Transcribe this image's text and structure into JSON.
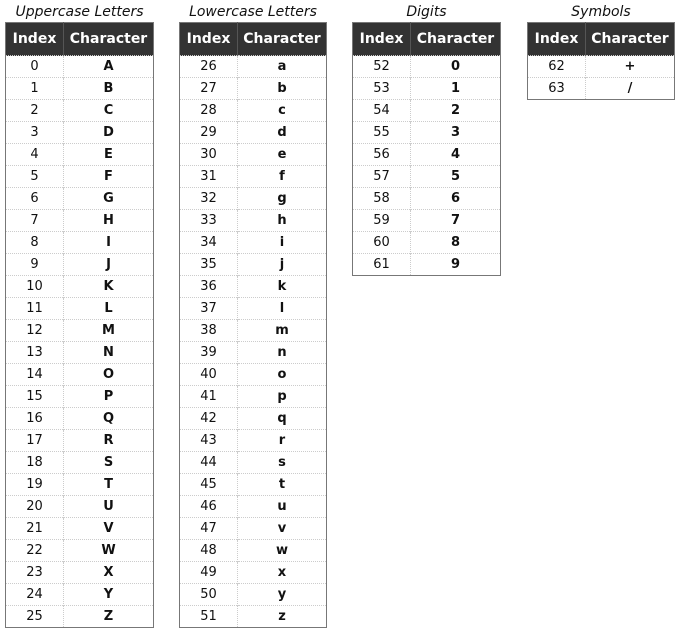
{
  "tables": [
    {
      "caption": "Uppercase Letters",
      "headers": [
        "Index",
        "Character"
      ],
      "rows": [
        [
          "0",
          "A"
        ],
        [
          "1",
          "B"
        ],
        [
          "2",
          "C"
        ],
        [
          "3",
          "D"
        ],
        [
          "4",
          "E"
        ],
        [
          "5",
          "F"
        ],
        [
          "6",
          "G"
        ],
        [
          "7",
          "H"
        ],
        [
          "8",
          "I"
        ],
        [
          "9",
          "J"
        ],
        [
          "10",
          "K"
        ],
        [
          "11",
          "L"
        ],
        [
          "12",
          "M"
        ],
        [
          "13",
          "N"
        ],
        [
          "14",
          "O"
        ],
        [
          "15",
          "P"
        ],
        [
          "16",
          "Q"
        ],
        [
          "17",
          "R"
        ],
        [
          "18",
          "S"
        ],
        [
          "19",
          "T"
        ],
        [
          "20",
          "U"
        ],
        [
          "21",
          "V"
        ],
        [
          "22",
          "W"
        ],
        [
          "23",
          "X"
        ],
        [
          "24",
          "Y"
        ],
        [
          "25",
          "Z"
        ]
      ]
    },
    {
      "caption": "Lowercase Letters",
      "headers": [
        "Index",
        "Character"
      ],
      "rows": [
        [
          "26",
          "a"
        ],
        [
          "27",
          "b"
        ],
        [
          "28",
          "c"
        ],
        [
          "29",
          "d"
        ],
        [
          "30",
          "e"
        ],
        [
          "31",
          "f"
        ],
        [
          "32",
          "g"
        ],
        [
          "33",
          "h"
        ],
        [
          "34",
          "i"
        ],
        [
          "35",
          "j"
        ],
        [
          "36",
          "k"
        ],
        [
          "37",
          "l"
        ],
        [
          "38",
          "m"
        ],
        [
          "39",
          "n"
        ],
        [
          "40",
          "o"
        ],
        [
          "41",
          "p"
        ],
        [
          "42",
          "q"
        ],
        [
          "43",
          "r"
        ],
        [
          "44",
          "s"
        ],
        [
          "45",
          "t"
        ],
        [
          "46",
          "u"
        ],
        [
          "47",
          "v"
        ],
        [
          "48",
          "w"
        ],
        [
          "49",
          "x"
        ],
        [
          "50",
          "y"
        ],
        [
          "51",
          "z"
        ]
      ]
    },
    {
      "caption": "Digits",
      "headers": [
        "Index",
        "Character"
      ],
      "rows": [
        [
          "52",
          "0"
        ],
        [
          "53",
          "1"
        ],
        [
          "54",
          "2"
        ],
        [
          "55",
          "3"
        ],
        [
          "56",
          "4"
        ],
        [
          "57",
          "5"
        ],
        [
          "58",
          "6"
        ],
        [
          "59",
          "7"
        ],
        [
          "60",
          "8"
        ],
        [
          "61",
          "9"
        ]
      ]
    },
    {
      "caption": "Symbols",
      "headers": [
        "Index",
        "Character"
      ],
      "rows": [
        [
          "62",
          "+"
        ],
        [
          "63",
          "/"
        ]
      ]
    }
  ]
}
